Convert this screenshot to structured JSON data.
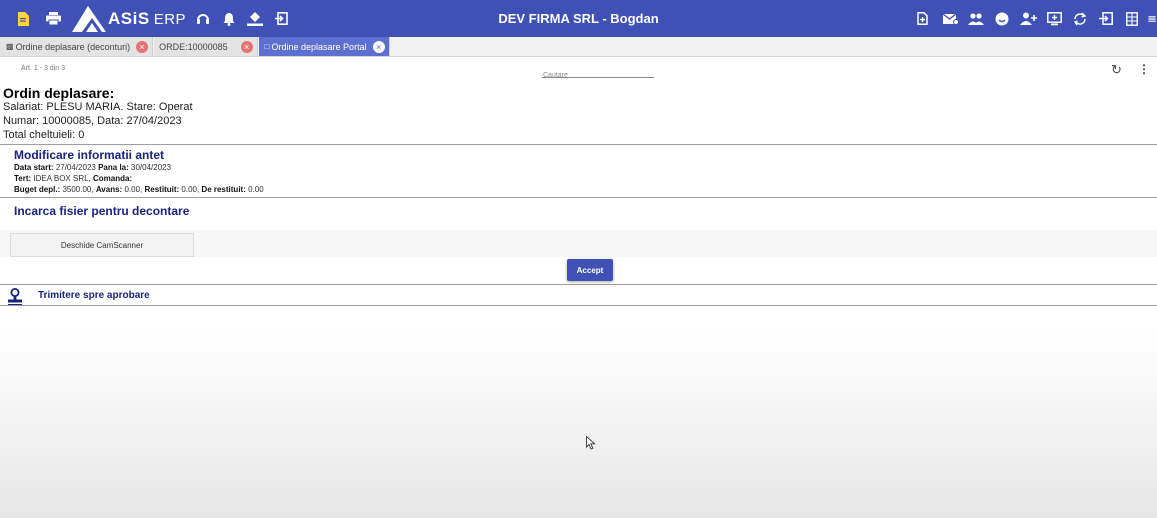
{
  "app": {
    "brand": "ASiS",
    "brand_suffix": "ERP",
    "title": "DEV FIRMA SRL - Bogdan",
    "accent_color": "#3f51b5"
  },
  "toolbar_left_icons": [
    "document-icon",
    "print-icon",
    "support-icon",
    "bell-icon",
    "paint-bucket-icon",
    "exit-icon"
  ],
  "toolbar_right_icons": [
    "add-document-icon",
    "mail-icon",
    "people-icon",
    "emoji-icon",
    "add-user-icon",
    "monitor-icon",
    "sync-icon",
    "login-icon",
    "columns-icon",
    "more-icon"
  ],
  "tabs": [
    {
      "label": "Ordine deplasare (deconturi)",
      "active": false
    },
    {
      "label": "ORDE:10000085",
      "active": false
    },
    {
      "label": "Ordine deplasare Portal",
      "active": true
    }
  ],
  "list": {
    "count_text": "Art. 1 - 3 din 3",
    "search_placeholder": "Cautare"
  },
  "document": {
    "title": "Ordin deplasare:",
    "employee_line": "Salariat: PLESU MARIA. Stare: Operat",
    "number_line": "Numar: 10000085, Data: 27/04/2023",
    "total_line": "Total cheltuieli: 0"
  },
  "header_section": {
    "title": "Modificare informatii antet",
    "start_label": "Data start:",
    "start_value": "27/04/2023",
    "end_label": "Pana la:",
    "end_value": "30/04/2023",
    "tert_label": "Tert:",
    "tert_value": "IDEA BOX SRL,",
    "order_label": "Comanda:",
    "order_value": "",
    "budget_label": "Buget depl.:",
    "budget_value": "3500.00,",
    "advance_label": "Avans:",
    "advance_value": "0.00,",
    "returned_label": "Restituit:",
    "returned_value": "0.00,",
    "to_return_label": "De restituit:",
    "to_return_value": "0.00"
  },
  "upload_section": {
    "title": "Incarca fisier pentru decontare",
    "camscanner_button": "Deschide CamScanner",
    "accept_button": "Accept"
  },
  "approval": {
    "label": "Trimitere spre aprobare"
  }
}
